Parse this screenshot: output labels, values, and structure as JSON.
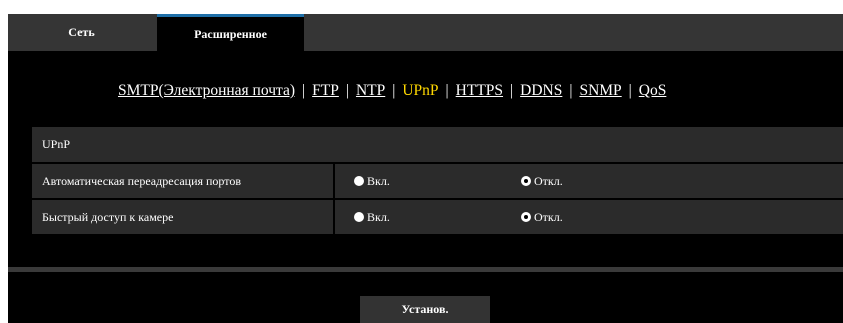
{
  "tabs": [
    {
      "label": "Сеть",
      "active": false
    },
    {
      "label": "Расширенное",
      "active": true
    }
  ],
  "subnav": {
    "links": [
      "SMTP(Электронная почта)",
      "FTP",
      "NTP",
      "UPnP",
      "HTTPS",
      "DDNS",
      "SNMP",
      "QoS"
    ],
    "current": "UPnP",
    "separator": "|"
  },
  "section": {
    "title": "UPnP",
    "rows": [
      {
        "label": "Автоматическая переадресация портов",
        "on_label": "Вкл.",
        "off_label": "Откл.",
        "selected": "off"
      },
      {
        "label": "Быстрый доступ к камере",
        "on_label": "Вкл.",
        "off_label": "Откл.",
        "selected": "off"
      }
    ]
  },
  "buttons": {
    "set_label": "Установ."
  },
  "colors": {
    "current_link": "#ffd800",
    "active_tab_border": "#1e6fa8",
    "row_bg": "#2b2b2b"
  }
}
